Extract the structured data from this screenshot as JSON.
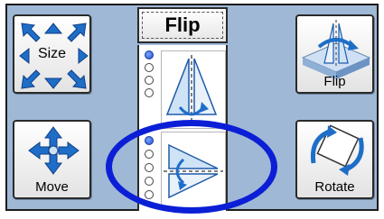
{
  "header": {
    "title": "Flip"
  },
  "buttons": {
    "size": "Size",
    "move": "Move",
    "flip": "Flip",
    "rotate": "Rotate"
  },
  "flip_options": [
    {
      "name": "vertical-flip",
      "selected": true
    },
    {
      "name": "horizontal-flip",
      "selected": true
    }
  ],
  "colors": {
    "panel": "#9fb8d6",
    "accent_blue": "#1e6ec8",
    "highlight": "#0b1fd6"
  },
  "icons": [
    "arrows-expand-icon",
    "move-cross-icon",
    "flip-icon",
    "rotate-icon",
    "flip-vertical-option-icon",
    "flip-horizontal-option-icon"
  ]
}
